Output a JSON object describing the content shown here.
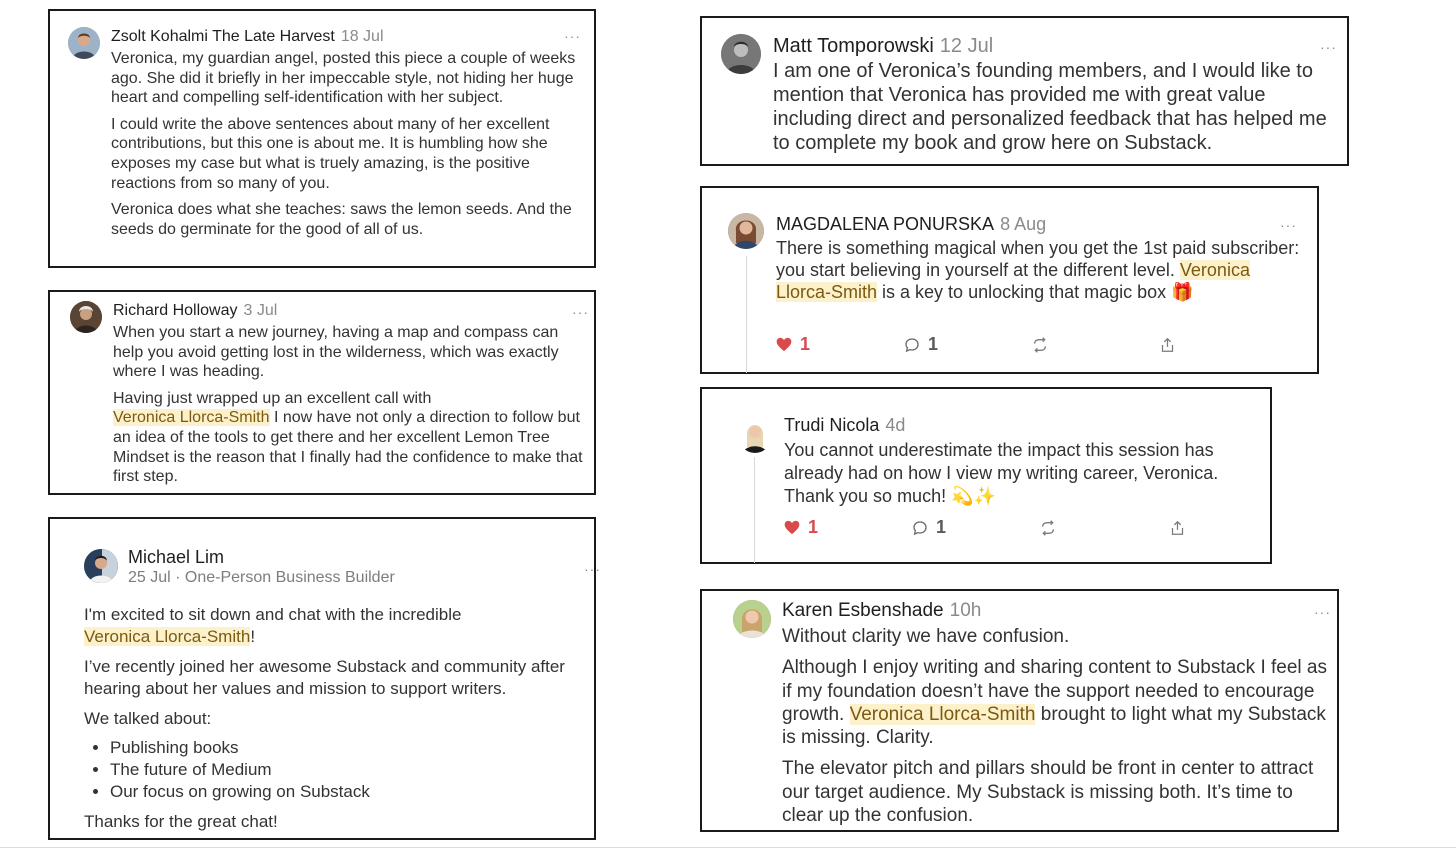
{
  "comments": {
    "zsolt": {
      "name": "Zsolt Kohalmi The Late Harvest",
      "date": "18 Jul",
      "menu": "···",
      "paragraphs": [
        "Veronica, my guardian angel, posted this piece a couple of weeks ago. She did it briefly in her impeccable style, not hiding her huge heart and compelling self-identification with her subject.",
        "I could write the above sentences about many of her excellent contributions, but this one is about me. It is humbling how she exposes my case but what is truely amazing, is the positive reactions from so many of you.",
        "Veronica does what she teaches: saws the lemon seeds. And the seeds do germinate for the good of all of us."
      ]
    },
    "richard": {
      "name": "Richard Holloway",
      "date": "3 Jul",
      "menu": "···",
      "p1": "When you start a new journey, having a map and compass can help you avoid getting lost in the wilderness, which was exactly where I was heading.",
      "p2_before": "Having just wrapped up an excellent call with",
      "mention": "Veronica Llorca-Smith",
      "p2_after": " I now have not only a direction to follow but an idea of the tools to get there and her excellent Lemon Tree Mindset is the reason that I finally had the confidence to make that first step."
    },
    "michael": {
      "name": "Michael Lim",
      "subline": "25 Jul · One-Person Business Builder",
      "menu": "···",
      "p1_before": "I'm excited to sit down and chat with the incredible",
      "mention": "Veronica Llorca-Smith",
      "p1_after": "!",
      "p2": "I’ve recently joined her awesome Substack and community after hearing about her values and mission to support writers.",
      "p3": "We talked about:",
      "topics": [
        "Publishing books",
        "The future of Medium",
        "Our focus on growing on Substack"
      ],
      "p4": "Thanks for the great chat!"
    },
    "matt": {
      "name": "Matt Tomporowski",
      "date": "12 Jul",
      "menu": "···",
      "text": "I am one of Veronica’s founding members, and I would like to mention that Veronica has provided me with great value including direct and personalized feedback that has helped me to complete my book and grow here on Substack."
    },
    "magdalena": {
      "name": "MAGDALENA PONURSKA",
      "date": "8 Aug",
      "menu": "···",
      "text_before": "There is something magical when you get the 1st paid subscriber: you start believing in yourself at the different level. ",
      "mention": "Veronica Llorca-Smith",
      "text_after": " is a key to unlocking that magic box",
      "emoji": "🎁",
      "likes": "1",
      "replies": "1"
    },
    "trudi": {
      "name": "Trudi Nicola",
      "date": "4d",
      "text": "You cannot underestimate the impact this session has already had on how I view my writing career, Veronica. Thank you so much!",
      "emoji": "💫✨",
      "likes": "1",
      "replies": "1"
    },
    "karen": {
      "name": "Karen Esbenshade",
      "date": "10h",
      "menu": "···",
      "p1": "Without clarity we have confusion.",
      "p2_before": "Although I enjoy writing and sharing content to Substack I feel as if my foundation doesn’t have the support needed to encourage growth. ",
      "mention": "Veronica Llorca-Smith",
      "p2_after": " brought to light what my Substack is missing. Clarity.",
      "p3": "The elevator pitch and pillars should be front in center to attract our target audience. My Substack is missing both. It’s time to clear up the confusion."
    }
  },
  "colors": {
    "border": "#1a1a1a",
    "highlight_bg": "#fdf1cc",
    "highlight_text": "#7a5a10",
    "heart": "#d94b4b",
    "muted": "#8a8a8a"
  },
  "icons": [
    "heart-icon",
    "comment-icon",
    "restack-icon",
    "share-icon"
  ]
}
